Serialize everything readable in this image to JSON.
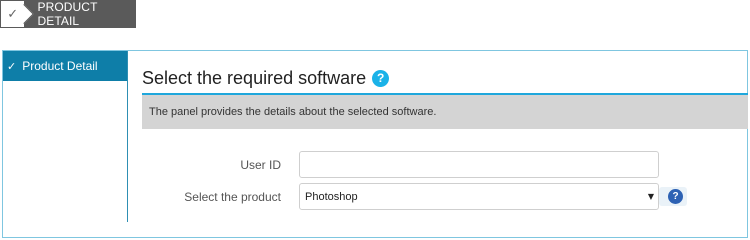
{
  "step": {
    "label": "PRODUCT DETAIL",
    "icon": "check-icon"
  },
  "sidebar": {
    "items": [
      {
        "label": "Product Detail",
        "icon": "check-icon",
        "active": true
      }
    ]
  },
  "main": {
    "title": "Select the required software",
    "help_icon_glyph": "?",
    "info_text": "The panel provides the details about the selected software."
  },
  "form": {
    "user_id": {
      "label": "User ID",
      "value": "",
      "placeholder": ""
    },
    "product": {
      "label": "Select the product",
      "selected": "Photoshop",
      "help_glyph": "?"
    }
  },
  "colors": {
    "accent": "#0e7ea8",
    "title_rule": "#1fa7dc",
    "help_title": "#1ab2e8",
    "help_field": "#2e62b4",
    "step_badge": "#5a5a5a",
    "panel_gray": "#d4d4d4"
  }
}
